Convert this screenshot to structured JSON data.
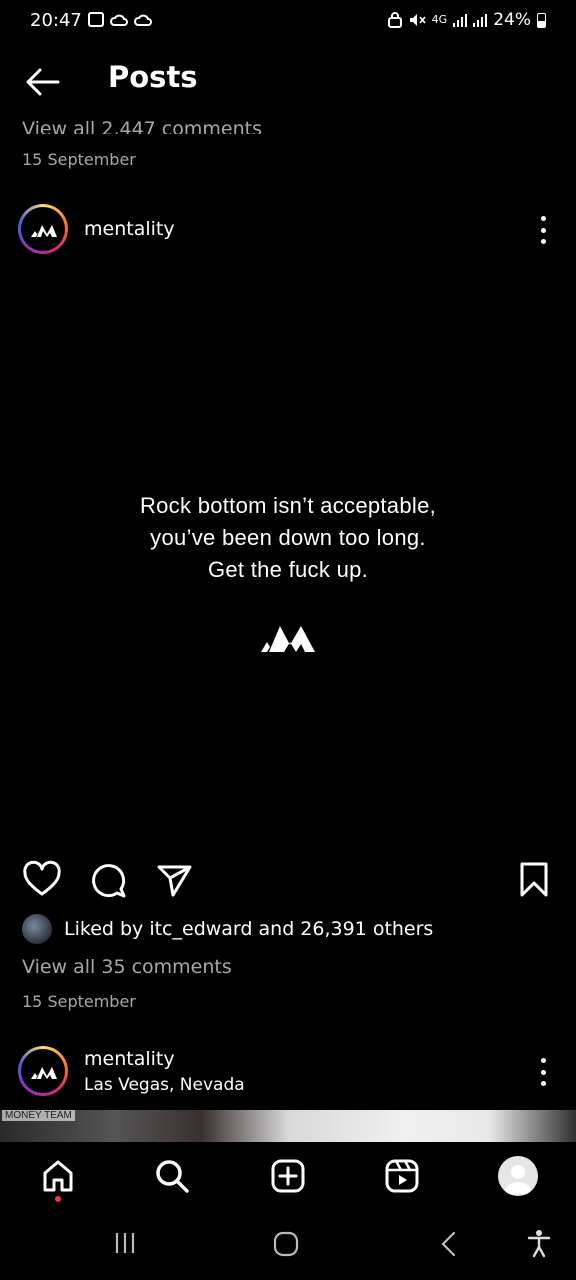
{
  "status_bar": {
    "time": "20:47",
    "network": "4G",
    "battery": "24%",
    "icons": [
      "gallery-icon",
      "cloud-icon",
      "cloud-icon",
      "lock-icon",
      "mute-icon",
      "signal-icon",
      "signal-icon",
      "battery-icon"
    ]
  },
  "header": {
    "title": "Posts",
    "back_icon": "arrow-left-icon"
  },
  "previous_post": {
    "comments_text": "View all 2,447 comments",
    "date": "15 September"
  },
  "post": {
    "username": "mentality",
    "quote_lines": [
      "Rock bottom isn’t acceptable,",
      "you’ve been down too long.",
      "Get the fuck up."
    ],
    "likes_text": "Liked by itc_edward and 26,391 others",
    "comments_text": "View all 35 comments",
    "date": "15 September"
  },
  "next_post": {
    "username": "mentality",
    "location": "Las Vegas, Nevada",
    "image_label": "MONEY TEAM"
  },
  "bottom_nav": {
    "items": [
      "home-icon",
      "search-icon",
      "create-icon",
      "reels-icon",
      "profile-icon"
    ]
  },
  "colors": {
    "background": "#000000",
    "text": "#ffffff",
    "secondary_text": "#a8a8a8",
    "notification_dot": "#ff3040"
  }
}
